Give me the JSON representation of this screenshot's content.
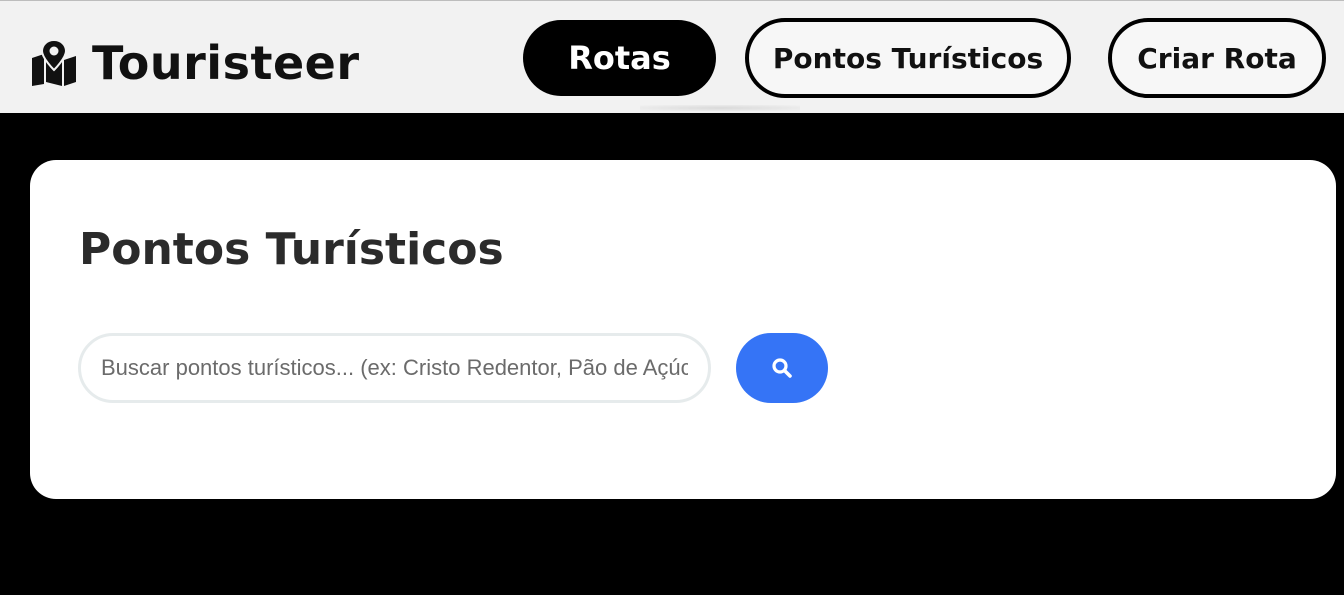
{
  "header": {
    "logo_icon": "map-marker-icon",
    "logo_text": "Touristeer",
    "nav": {
      "rotas_label": "Rotas",
      "pontos_label": "Pontos Turísticos",
      "criar_label": "Criar Rota"
    }
  },
  "main": {
    "title": "Pontos Turísticos",
    "search": {
      "placeholder": "Buscar pontos turísticos... (ex: Cristo Redentor, Pão de Açúcar)",
      "value": "",
      "button_icon": "search-icon"
    }
  },
  "colors": {
    "header_bg": "#f2f2f2",
    "page_bg": "#000000",
    "card_bg": "#ffffff",
    "search_button": "#3574f6",
    "active_nav_bg": "#000000"
  }
}
